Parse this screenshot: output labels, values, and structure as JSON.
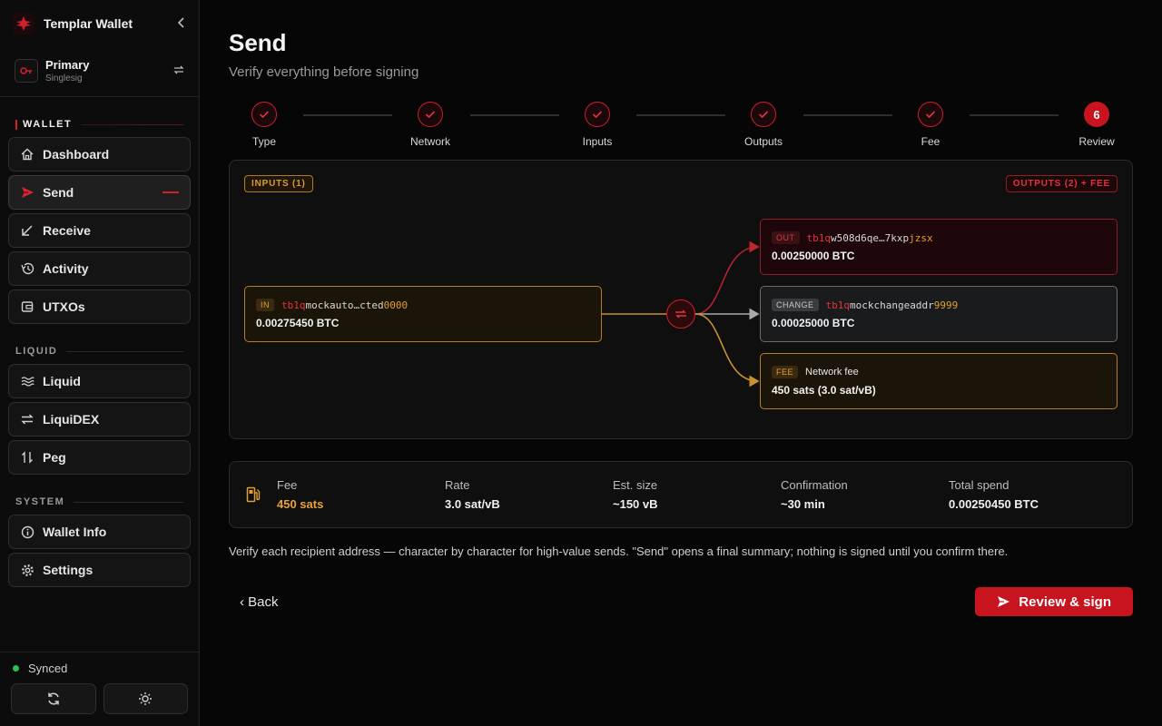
{
  "app": {
    "title": "Templar Wallet"
  },
  "account": {
    "name": "Primary",
    "type": "Singlesig"
  },
  "sidebar": {
    "sections": [
      {
        "label": "WALLET",
        "items": [
          {
            "label": "Dashboard",
            "icon": "home-icon"
          },
          {
            "label": "Send",
            "icon": "send-icon",
            "active": true
          },
          {
            "label": "Receive",
            "icon": "receive-arrow-icon"
          },
          {
            "label": "Activity",
            "icon": "history-icon"
          },
          {
            "label": "UTXOs",
            "icon": "wallet-icon"
          }
        ]
      },
      {
        "label": "LIQUID",
        "items": [
          {
            "label": "Liquid",
            "icon": "waves-icon"
          },
          {
            "label": "LiquiDEX",
            "icon": "swap-icon"
          },
          {
            "label": "Peg",
            "icon": "peg-arrows-icon"
          }
        ]
      },
      {
        "label": "SYSTEM",
        "items": [
          {
            "label": "Wallet Info",
            "icon": "info-icon"
          },
          {
            "label": "Settings",
            "icon": "gear-icon"
          }
        ]
      }
    ],
    "status": "Synced"
  },
  "page": {
    "title": "Send",
    "subtitle": "Verify everything before signing"
  },
  "steps": [
    {
      "label": "Type",
      "done": true
    },
    {
      "label": "Network",
      "done": true
    },
    {
      "label": "Inputs",
      "done": true
    },
    {
      "label": "Outputs",
      "done": true
    },
    {
      "label": "Fee",
      "done": true
    },
    {
      "label": "Review",
      "number": "6",
      "current": true
    }
  ],
  "flow": {
    "inputs_badge": "INPUTS (1)",
    "outputs_badge": "OUTPUTS (2) + FEE",
    "input": {
      "tag": "IN",
      "addr_prefix": "tb1q",
      "addr_mid": "mockauto…cted",
      "addr_suffix": "0000",
      "amount": "0.00275450 BTC"
    },
    "output": {
      "tag": "OUT",
      "addr_prefix": "tb1q",
      "addr_mid": "w508d6qe…7kxp",
      "addr_suffix": "jzsx",
      "amount": "0.00250000 BTC"
    },
    "change": {
      "tag": "CHANGE",
      "addr_prefix": "tb1q",
      "addr_mid": "mockchangeaddr",
      "addr_suffix": "9999",
      "amount": "0.00025000 BTC"
    },
    "fee": {
      "tag": "FEE",
      "label": "Network fee",
      "amount": "450 sats (3.0 sat/vB)"
    }
  },
  "summary": {
    "fee": {
      "label": "Fee",
      "value": "450 sats"
    },
    "rate": {
      "label": "Rate",
      "value": "3.0 sat/vB"
    },
    "size": {
      "label": "Est. size",
      "value": "~150 vB"
    },
    "confirmation": {
      "label": "Confirmation",
      "value": "~30 min"
    },
    "total": {
      "label": "Total spend",
      "value": "0.00250450 BTC"
    }
  },
  "note": "Verify each recipient address — character by character for high-value sends. \"Send\" opens a final summary; nothing is signed until you confirm there.",
  "actions": {
    "back": "‹ Back",
    "primary": "Review & sign"
  },
  "colors": {
    "accent": "#c8141f",
    "amber": "#e0a030"
  }
}
